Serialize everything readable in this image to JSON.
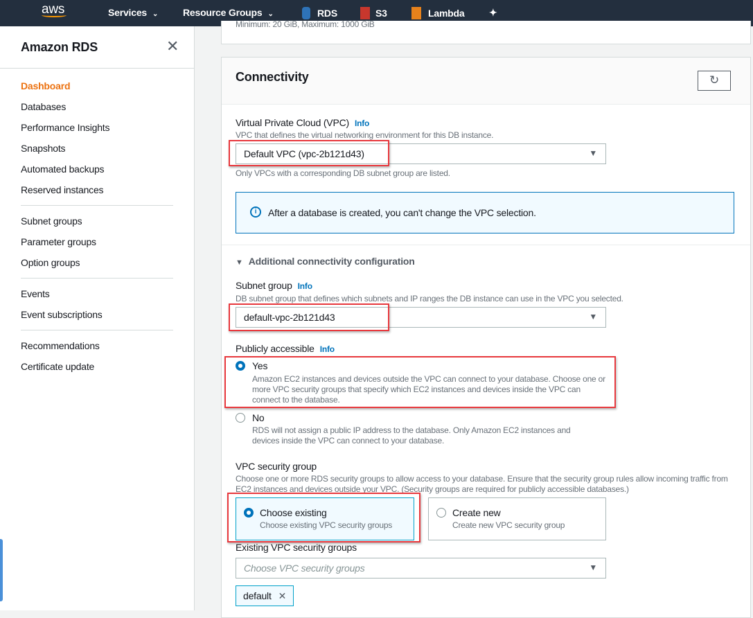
{
  "topnav": {
    "logo": "aws",
    "services": "Services",
    "resource_groups": "Resource Groups",
    "rds": "RDS",
    "s3": "S3",
    "lambda": "Lambda"
  },
  "sidebar": {
    "title": "Amazon RDS",
    "items": [
      "Dashboard",
      "Databases",
      "Performance Insights",
      "Snapshots",
      "Automated backups",
      "Reserved instances",
      "Subnet groups",
      "Parameter groups",
      "Option groups",
      "Events",
      "Event subscriptions",
      "Recommendations",
      "Certificate update"
    ]
  },
  "prev_panel": {
    "cut_text": "Minimum: 20 GiB, Maximum: 1000 GiB"
  },
  "connectivity": {
    "title": "Connectivity",
    "vpc": {
      "label": "Virtual Private Cloud (VPC)",
      "info": "Info",
      "desc": "VPC that defines the virtual networking environment for this DB instance.",
      "value": "Default VPC (vpc-2b121d43)",
      "hint": "Only VPCs with a corresponding DB subnet group are listed.",
      "alert": "After a database is created, you can't change the VPC selection."
    },
    "additional": "Additional connectivity configuration",
    "subnet": {
      "label": "Subnet group",
      "info": "Info",
      "desc": "DB subnet group that defines which subnets and IP ranges the DB instance can use in the VPC you selected.",
      "value": "default-vpc-2b121d43"
    },
    "public": {
      "label": "Publicly accessible",
      "info": "Info",
      "options": [
        {
          "label": "Yes",
          "desc": "Amazon EC2 instances and devices outside the VPC can connect to your database. Choose one or more VPC security groups that specify which EC2 instances and devices inside the VPC can connect to the database.",
          "selected": true
        },
        {
          "label": "No",
          "desc": "RDS will not assign a public IP address to the database. Only Amazon EC2 instances and devices inside the VPC can connect to your database.",
          "selected": false
        }
      ]
    },
    "sg": {
      "label": "VPC security group",
      "desc": "Choose one or more RDS security groups to allow access to your database. Ensure that the security group rules allow incoming traffic from EC2 instances and devices outside your VPC. (Security groups are required for publicly accessible databases.)",
      "tiles": [
        {
          "label": "Choose existing",
          "desc": "Choose existing VPC security groups",
          "selected": true
        },
        {
          "label": "Create new",
          "desc": "Create new VPC security group",
          "selected": false
        }
      ],
      "existing_label": "Existing VPC security groups",
      "placeholder": "Choose VPC security groups",
      "token": "default"
    }
  }
}
